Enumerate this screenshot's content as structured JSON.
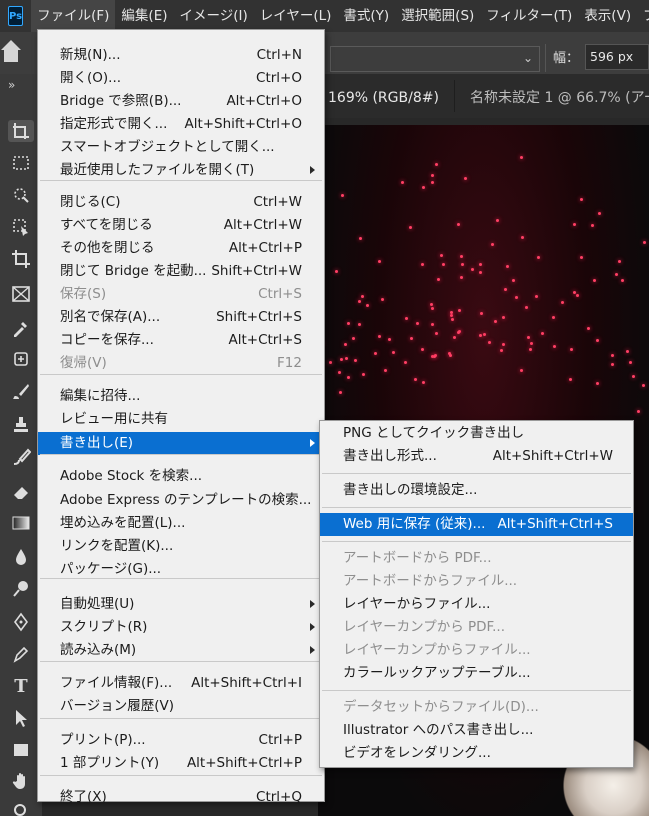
{
  "menubar": {
    "logo": "Ps",
    "items": [
      "ファイル(F)",
      "編集(E)",
      "イメージ(I)",
      "レイヤー(L)",
      "書式(Y)",
      "選択範囲(S)",
      "フィルター(T)",
      "表示(V)",
      "プラ"
    ]
  },
  "options": {
    "width_label": "幅：",
    "width_value": "596 px"
  },
  "toolbar": {
    "collapse": "»"
  },
  "tabs": {
    "tab1": "169% (RGB/8#)",
    "tab2": "名称未設定 1 @ 66.7% (アー"
  },
  "file_menu": [
    {
      "label": "新規(N)...",
      "shortcut": "Ctrl+N"
    },
    {
      "label": "開く(O)...",
      "shortcut": "Ctrl+O"
    },
    {
      "label": "Bridge で参照(B)...",
      "shortcut": "Alt+Ctrl+O"
    },
    {
      "label": "指定形式で開く...",
      "shortcut": "Alt+Shift+Ctrl+O"
    },
    {
      "label": "スマートオブジェクトとして開く...",
      "shortcut": ""
    },
    {
      "label": "最近使用したファイルを開く(T)",
      "shortcut": ""
    },
    {
      "label": "閉じる(C)",
      "shortcut": "Ctrl+W"
    },
    {
      "label": "すべてを閉じる",
      "shortcut": "Alt+Ctrl+W"
    },
    {
      "label": "その他を閉じる",
      "shortcut": "Alt+Ctrl+P"
    },
    {
      "label": "閉じて Bridge を起動...",
      "shortcut": "Shift+Ctrl+W"
    },
    {
      "label": "保存(S)",
      "shortcut": "Ctrl+S"
    },
    {
      "label": "別名で保存(A)...",
      "shortcut": "Shift+Ctrl+S"
    },
    {
      "label": "コピーを保存...",
      "shortcut": "Alt+Ctrl+S"
    },
    {
      "label": "復帰(V)",
      "shortcut": "F12"
    },
    {
      "label": "編集に招待...",
      "shortcut": ""
    },
    {
      "label": "レビュー用に共有",
      "shortcut": ""
    },
    {
      "label": "書き出し(E)",
      "shortcut": ""
    },
    {
      "label": "Adobe Stock を検索...",
      "shortcut": ""
    },
    {
      "label": "Adobe Express のテンプレートの検索...",
      "shortcut": ""
    },
    {
      "label": "埋め込みを配置(L)...",
      "shortcut": ""
    },
    {
      "label": "リンクを配置(K)...",
      "shortcut": ""
    },
    {
      "label": "パッケージ(G)...",
      "shortcut": ""
    },
    {
      "label": "自動処理(U)",
      "shortcut": ""
    },
    {
      "label": "スクリプト(R)",
      "shortcut": ""
    },
    {
      "label": "読み込み(M)",
      "shortcut": ""
    },
    {
      "label": "ファイル情報(F)...",
      "shortcut": "Alt+Shift+Ctrl+I"
    },
    {
      "label": "バージョン履歴(V)",
      "shortcut": ""
    },
    {
      "label": "プリント(P)...",
      "shortcut": "Ctrl+P"
    },
    {
      "label": "1 部プリント(Y)",
      "shortcut": "Alt+Shift+Ctrl+P"
    },
    {
      "label": "終了(X)",
      "shortcut": "Ctrl+Q"
    }
  ],
  "export_menu": [
    {
      "label": "PNG としてクイック書き出し",
      "shortcut": ""
    },
    {
      "label": "書き出し形式...",
      "shortcut": "Alt+Shift+Ctrl+W"
    },
    {
      "label": "書き出しの環境設定...",
      "shortcut": ""
    },
    {
      "label": "Web 用に保存 (従来)...",
      "shortcut": "Alt+Shift+Ctrl+S"
    },
    {
      "label": "アートボードから PDF...",
      "shortcut": ""
    },
    {
      "label": "アートボードからファイル...",
      "shortcut": ""
    },
    {
      "label": "レイヤーからファイル...",
      "shortcut": ""
    },
    {
      "label": "レイヤーカンプから PDF...",
      "shortcut": ""
    },
    {
      "label": "レイヤーカンプからファイル...",
      "shortcut": ""
    },
    {
      "label": "カラールックアップテーブル...",
      "shortcut": ""
    },
    {
      "label": "データセットからファイル(D)...",
      "shortcut": ""
    },
    {
      "label": "Illustrator へのパス書き出し...",
      "shortcut": ""
    },
    {
      "label": "ビデオをレンダリング...",
      "shortcut": ""
    }
  ]
}
